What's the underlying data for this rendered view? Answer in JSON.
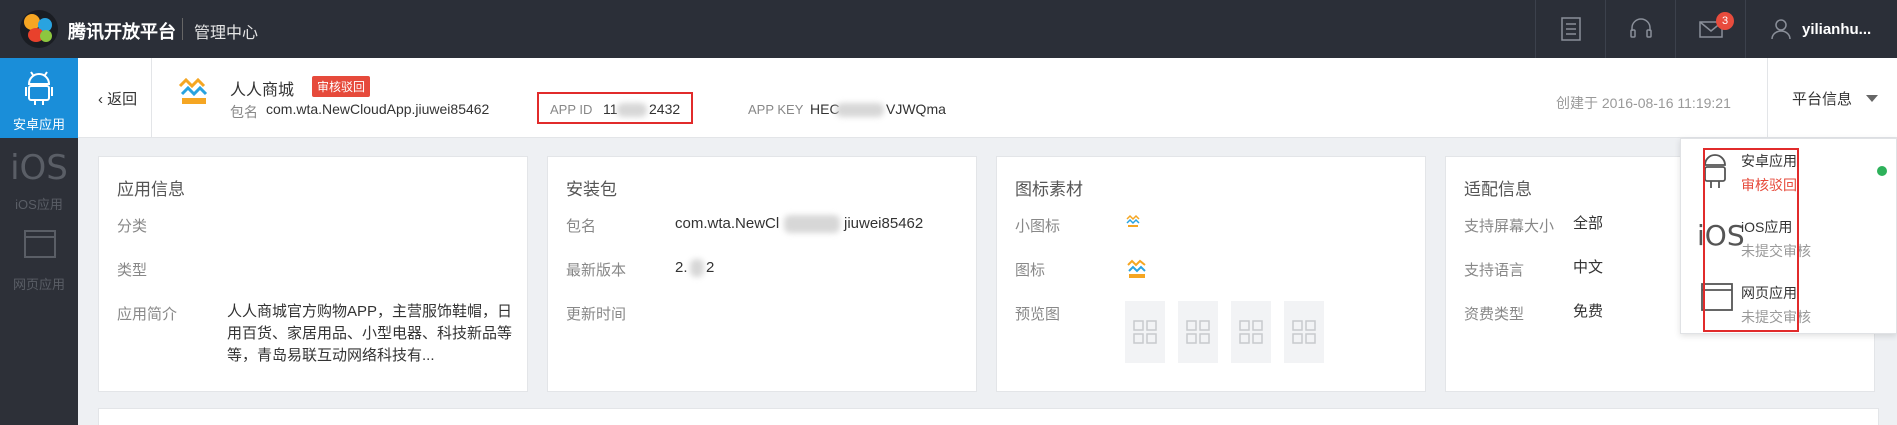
{
  "topbar": {
    "brand": "腾讯开放平台",
    "section": "管理中心",
    "mail_badge": "3",
    "username": "yilianhu..."
  },
  "sidebar": {
    "items": [
      {
        "label": "安卓应用",
        "icon": "android-icon",
        "active": true
      },
      {
        "label": "iOS应用",
        "icon_text": "iOS",
        "active": false
      },
      {
        "label": "网页应用",
        "icon": "browser-window-icon",
        "active": false
      }
    ]
  },
  "header": {
    "back_label": "返回",
    "app_name": "人人商城",
    "status_tag": "审核驳回",
    "pkg_label": "包名",
    "pkg_value": "com.wta.NewCloudApp.jiuwei85462",
    "appid_label": "APP ID",
    "appid_value_start": "11",
    "appid_value_end": "2432",
    "appkey_label": "APP KEY",
    "appkey_value_start": "HEC",
    "appkey_value_end": "VJWQma",
    "created": "创建于 2016-08-16 11:19:21",
    "platform_btn": "平台信息"
  },
  "cards": {
    "app_info": {
      "title": "应用信息",
      "rows": [
        {
          "label": "分类",
          "value": ""
        },
        {
          "label": "类型",
          "value": ""
        },
        {
          "label": "应用简介",
          "value": "人人商城官方购物APP，主营服饰鞋帽，日用百货、家居用品、小型电器、科技新品等等，青岛易联互动网络科技有..."
        }
      ]
    },
    "package": {
      "title": "安装包",
      "pkg_label": "包名",
      "pkg_value_start": "com.wta.NewCl",
      "pkg_value_end": "jiuwei85462",
      "version_label": "最新版本",
      "version_start": "2.",
      "version_end": "2",
      "update_label": "更新时间",
      "update_value": ""
    },
    "icons": {
      "title": "图标素材",
      "small_label": "小图标",
      "icon_label": "图标",
      "preview_label": "预览图"
    },
    "adapt": {
      "title": "适配信息",
      "rows": [
        {
          "label": "支持屏幕大小",
          "value": "全部"
        },
        {
          "label": "支持语言",
          "value": "中文"
        },
        {
          "label": "资费类型",
          "value": "免费"
        }
      ]
    }
  },
  "dropdown": {
    "items": [
      {
        "name": "安卓应用",
        "status": "审核驳回"
      },
      {
        "name": "iOS应用",
        "status": "未提交审核",
        "icon_text": "iOS"
      },
      {
        "name": "网页应用",
        "status": "未提交审核"
      }
    ]
  },
  "colors": {
    "topbar": "#2b2f38",
    "accent_blue": "#1a8ed9",
    "status_red": "#e64a3b",
    "highlight_red": "#e12b2b",
    "online_green": "#2db15a"
  }
}
